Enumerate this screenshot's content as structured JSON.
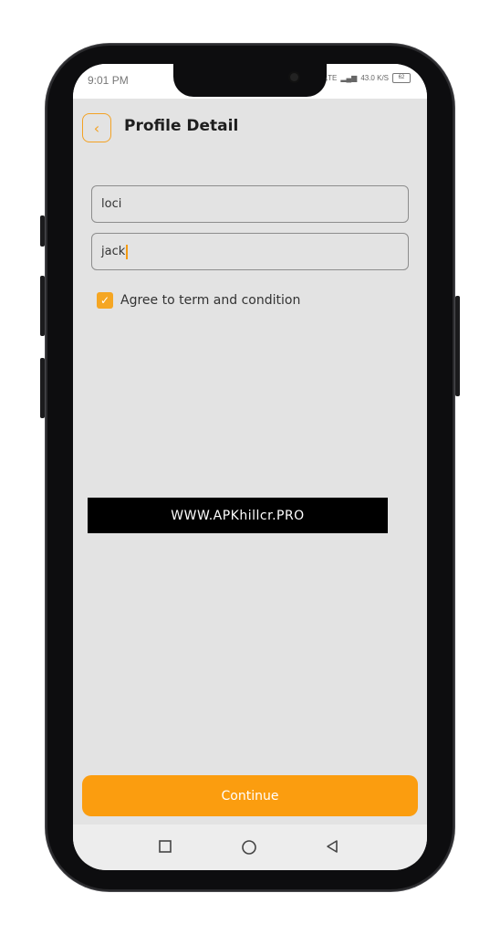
{
  "status_bar": {
    "time": "9:01 PM",
    "network_text": "Vo LTE",
    "speed_text": "43.0 K/S",
    "battery_text": "62"
  },
  "header": {
    "back_icon": "chevron-left-icon",
    "title": "Profile Detail"
  },
  "form": {
    "first_name_value": "loci",
    "last_name_value": "jack",
    "agree_checked": true,
    "agree_label": "Agree to term and condition"
  },
  "watermark": {
    "text": "WWW.APKhillcr.PRO"
  },
  "continue_button": {
    "label": "Continue"
  },
  "nav_bar": {
    "recents_icon": "square-icon",
    "home_icon": "circle-icon",
    "back_icon": "triangle-back-icon"
  },
  "colors": {
    "accent": "#fb9d0f",
    "screen_background": "#e3e3e3",
    "watermark_background": "#000000"
  }
}
